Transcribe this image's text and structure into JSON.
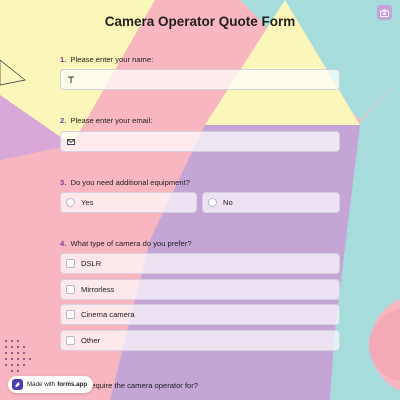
{
  "form_title": "Camera Operator Quote Form",
  "questions": [
    {
      "number": "1.",
      "label": "Please enter your name:",
      "type": "text",
      "value": ""
    },
    {
      "number": "2.",
      "label": "Please enter your email:",
      "type": "email",
      "value": ""
    },
    {
      "number": "3.",
      "label": "Do you need additional equipment?",
      "type": "radio",
      "options": [
        "Yes",
        "No"
      ]
    },
    {
      "number": "4.",
      "label": "What type of camera do you prefer?",
      "type": "checkbox",
      "options": [
        "DSLR",
        "Mirrorless",
        "Cinema camera",
        "Other"
      ]
    },
    {
      "label_partial": "any you require the camera operator for?"
    }
  ],
  "badge": {
    "prefix": "Made with",
    "brand": "forms.app"
  },
  "icons": {
    "corner": "camera-icon",
    "name_field": "text-cursor-icon",
    "email_field": "envelope-icon",
    "badge": "forms-app-logo-icon"
  },
  "colors": {
    "background_pink": "#f7b6c0",
    "accent_yellow": "#fbf6b9",
    "accent_purple": "#c4a5d6",
    "accent_teal": "#a7dcdc",
    "question_number": "#7b3fa0"
  }
}
